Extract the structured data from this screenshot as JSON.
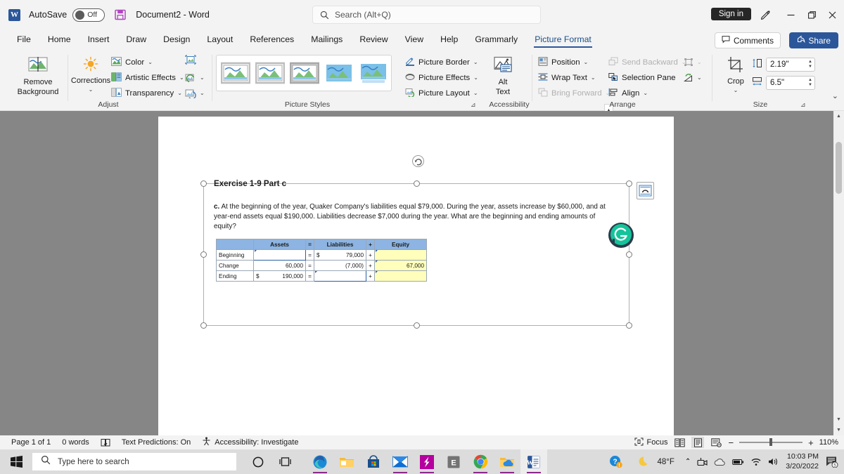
{
  "titlebar": {
    "app_icon": "word-icon",
    "autosave_label": "AutoSave",
    "autosave_state": "Off",
    "save_icon": "save-icon",
    "document_title": "Document2  -  Word",
    "signin_label": "Sign in",
    "pen_icon": "pen-icon",
    "minimize_icon": "minimize-icon",
    "maximize_icon": "restore-icon",
    "close_icon": "close-icon"
  },
  "search": {
    "placeholder": "Search (Alt+Q)",
    "icon": "search-icon"
  },
  "tabs": [
    {
      "label": "File",
      "active": false
    },
    {
      "label": "Home",
      "active": false
    },
    {
      "label": "Insert",
      "active": false
    },
    {
      "label": "Draw",
      "active": false
    },
    {
      "label": "Design",
      "active": false
    },
    {
      "label": "Layout",
      "active": false
    },
    {
      "label": "References",
      "active": false
    },
    {
      "label": "Mailings",
      "active": false
    },
    {
      "label": "Review",
      "active": false
    },
    {
      "label": "View",
      "active": false
    },
    {
      "label": "Help",
      "active": false
    },
    {
      "label": "Grammarly",
      "active": false
    },
    {
      "label": "Picture Format",
      "active": true
    }
  ],
  "tab_actions": {
    "comments_label": "Comments",
    "comments_icon": "comment-icon",
    "share_label": "Share",
    "share_icon": "share-icon"
  },
  "ribbon": {
    "adjust": {
      "group_label": "Adjust",
      "remove_background": "Remove Background",
      "remove_background_icon": "remove-background-icon",
      "corrections": "Corrections",
      "corrections_icon": "brightness-icon",
      "color": "Color",
      "color_icon": "color-icon",
      "artistic_effects": "Artistic Effects",
      "artistic_effects_icon": "artistic-effects-icon",
      "transparency": "Transparency",
      "transparency_icon": "transparency-icon",
      "compress_icon": "compress-pictures-icon",
      "change_icon": "change-picture-icon",
      "reset_icon": "reset-picture-icon"
    },
    "picture_styles": {
      "group_label": "Picture Styles",
      "thumb_count": 5,
      "scroll_up_icon": "scroll-up-icon",
      "scroll_down_icon": "scroll-down-icon",
      "more_icon": "more-styles-icon",
      "picture_border": "Picture Border",
      "picture_border_icon": "picture-border-icon",
      "picture_effects": "Picture Effects",
      "picture_effects_icon": "picture-effects-icon",
      "picture_layout": "Picture Layout",
      "picture_layout_icon": "picture-layout-icon"
    },
    "accessibility": {
      "group_label": "Accessibility",
      "alt_text_line1": "Alt",
      "alt_text_line2": "Text",
      "alt_text_icon": "alt-text-icon",
      "dialog_launcher_icon": "dialog-launcher-icon"
    },
    "arrange": {
      "group_label": "Arrange",
      "position": "Position",
      "position_icon": "position-icon",
      "wrap_text": "Wrap Text",
      "wrap_text_icon": "wrap-text-icon",
      "bring_forward": "Bring Forward",
      "bring_forward_icon": "bring-forward-icon",
      "send_backward": "Send Backward",
      "send_backward_icon": "send-backward-icon",
      "selection_pane": "Selection Pane",
      "selection_pane_icon": "selection-pane-icon",
      "align": "Align",
      "align_icon": "align-icon",
      "group_objects_icon": "group-objects-icon",
      "rotate_icon": "rotate-icon"
    },
    "size": {
      "group_label": "Size",
      "crop_label": "Crop",
      "crop_icon": "crop-icon",
      "height_icon": "shape-height-icon",
      "height_value": "2.19\"",
      "width_icon": "shape-width-icon",
      "width_value": "6.5\"",
      "dialog_launcher_icon": "dialog-launcher-icon"
    },
    "collapse_icon": "collapse-ribbon-icon"
  },
  "document": {
    "exercise_title": "Exercise 1-9 Part c",
    "exercise_body_prefix": "c.",
    "exercise_body": " At the beginning of the year, Quaker Company's liabilities equal $79,000. During the year, assets increase by $60,000, and at year-end assets equal $190,000. Liabilities decrease $7,000 during the year. What are the beginning and ending amounts of equity?",
    "layout_options_icon": "layout-options-icon",
    "rotate_handle_icon": "rotate-handle-icon",
    "grammarly_icon": "grammarly-icon",
    "table": {
      "headers": [
        "",
        "Assets",
        "=",
        "Liabilities",
        "+",
        "Equity"
      ],
      "rows": [
        {
          "label": "Beginning",
          "assets": "",
          "assets_dollar": "",
          "eq": "=",
          "liabilities": "79,000",
          "liabilities_dollar": "$",
          "plus": "+",
          "equity": ""
        },
        {
          "label": "Change",
          "assets": "60,000",
          "assets_dollar": "",
          "eq": "=",
          "liabilities": "(7,000)",
          "liabilities_dollar": "",
          "plus": "+",
          "equity": "67,000"
        },
        {
          "label": "Ending",
          "assets": "190,000",
          "assets_dollar": "$",
          "eq": "=",
          "liabilities": "",
          "liabilities_dollar": "",
          "plus": "+",
          "equity": ""
        }
      ]
    }
  },
  "statusbar": {
    "page_info": "Page 1 of 1",
    "word_count": "0 words",
    "proofing_icon": "proofing-icon",
    "text_predictions": "Text Predictions: On",
    "accessibility_icon": "accessibility-icon",
    "accessibility": "Accessibility: Investigate",
    "focus_label": "Focus",
    "focus_icon": "focus-icon",
    "read_mode_icon": "read-mode-icon",
    "print_layout_icon": "print-layout-icon",
    "web_layout_icon": "web-layout-icon",
    "zoom_out_icon": "zoom-out-icon",
    "zoom_in_icon": "zoom-in-icon",
    "zoom_level": "110%"
  },
  "taskbar": {
    "start_icon": "windows-start-icon",
    "search_placeholder": "Type here to search",
    "search_icon": "search-icon",
    "cortana_icon": "cortana-icon",
    "task_view_icon": "task-view-icon",
    "apps": [
      {
        "name": "edge-icon",
        "running": true,
        "active": false
      },
      {
        "name": "file-explorer-icon",
        "running": false,
        "active": false
      },
      {
        "name": "microsoft-store-icon",
        "running": false,
        "active": false
      },
      {
        "name": "mail-icon",
        "running": true,
        "active": false
      },
      {
        "name": "sharex-icon",
        "running": true,
        "active": false
      },
      {
        "name": "excel-icon",
        "running": false,
        "active": false
      },
      {
        "name": "chrome-icon",
        "running": true,
        "active": false
      },
      {
        "name": "onedrive-folder-icon",
        "running": true,
        "active": false
      },
      {
        "name": "word-icon",
        "running": true,
        "active": true
      }
    ],
    "tray": {
      "help_icon": "help-notification-icon",
      "weather_icon": "moon-icon",
      "temperature": "48°F",
      "chevron_icon": "show-hidden-icons-icon",
      "camera_icon": "camera-icon",
      "onedrive_icon": "onedrive-icon",
      "battery_icon": "battery-icon",
      "wifi_icon": "wifi-icon",
      "volume_icon": "volume-icon",
      "time": "10:03 PM",
      "date": "3/20/2022",
      "notifications_icon": "notifications-icon",
      "notifications_count": "5"
    }
  }
}
